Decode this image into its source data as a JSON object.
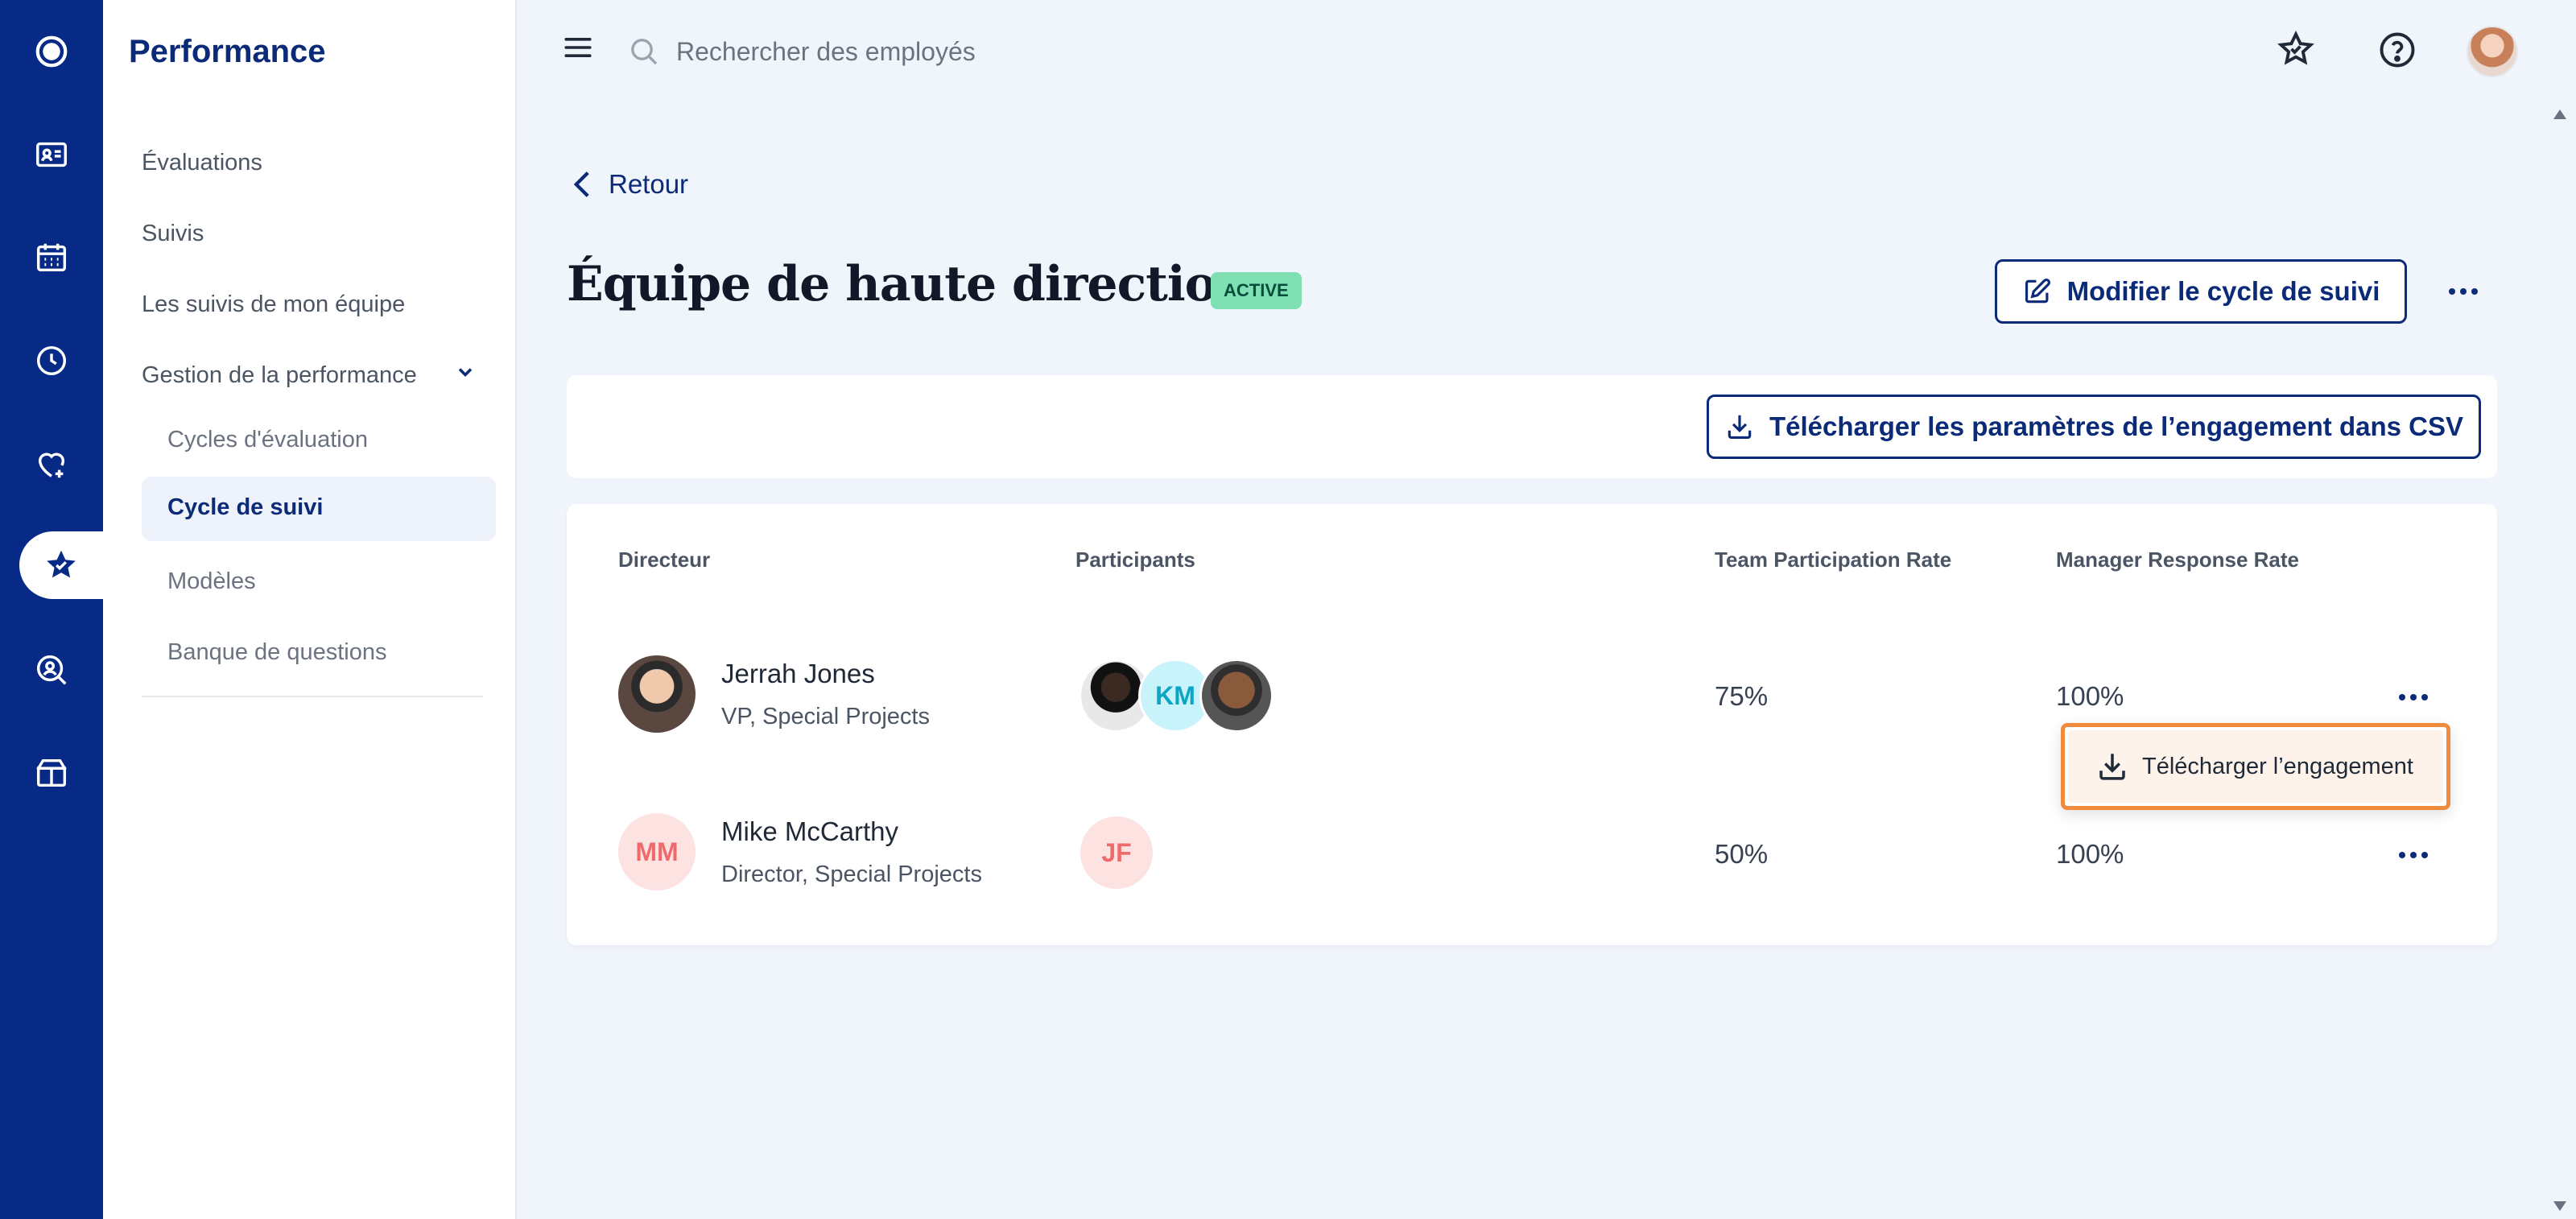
{
  "sidebar": {
    "title": "Performance",
    "items": [
      "Évaluations",
      "Suivis",
      "Les suivis de mon équipe",
      "Gestion de la performance"
    ],
    "subitems": [
      "Cycles d'évaluation",
      "Cycle de suivi",
      "Modèles",
      "Banque de questions"
    ]
  },
  "search": {
    "placeholder": "Rechercher des employés"
  },
  "header": {
    "back_label": "Retour",
    "title": "Équipe de haute direction",
    "status_badge": "ACTIVE",
    "edit_button": "Modifier le cycle de suivi",
    "csv_button": "Télécharger les paramètres de l’engagement dans CSV"
  },
  "table": {
    "columns": [
      "Directeur",
      "Participants",
      "Team Participation Rate",
      "Manager Response Rate"
    ],
    "rows": [
      {
        "name": "Jerrah Jones",
        "role": "VP, Special Projects",
        "participants": [
          "KM"
        ],
        "team_rate": "75%",
        "manager_rate": "100%"
      },
      {
        "name": "Mike McCarthy",
        "role": "Director, Special Projects",
        "initials": "MM",
        "participants": [
          "JF"
        ],
        "team_rate": "50%",
        "manager_rate": "100%"
      }
    ]
  },
  "popover": {
    "label": "Télécharger l’engagement"
  },
  "colors": {
    "brand": "#072a86",
    "badge": "#7fe0b4",
    "highlight": "#f08a3c"
  }
}
